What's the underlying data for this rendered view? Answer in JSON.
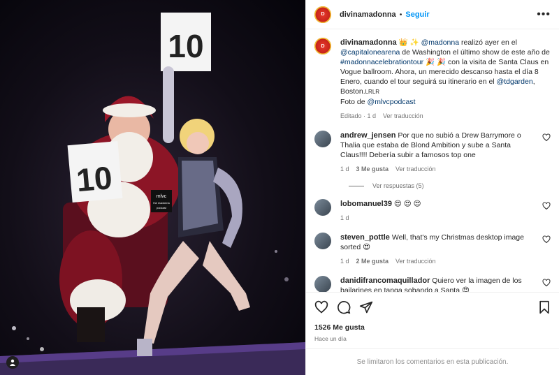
{
  "post": {
    "username": "divinamadonna",
    "follow_label": "Seguir",
    "more_label": "•••",
    "avatar_text": "D",
    "caption": {
      "badges": "👑 ✨",
      "mention_1": "@madonna",
      "text_1": " realizó ayer en el ",
      "mention_2": "@capitalonearena",
      "text_2": " de Washington el último show de este año de ",
      "hashtag": "#madonnacelebrationtour",
      "text_3": " 🎉 🎉  con la visita de Santa Claus en Vogue ballroom. Ahora, un merecido descanso hasta el día 8 Enero, cuando el tour seguirá su itinerario en el ",
      "mention_3": "@tdgarden",
      "text_4": ", Boston.",
      "small_tag": "LRLR",
      "photo_credit": "Foto de ",
      "mention_4": "@mlvcpodcast",
      "edited": "Editado",
      "time": "1 d",
      "translate": "Ver traducción"
    }
  },
  "comments": [
    {
      "user": "andrew_jensen",
      "text": "Por que no subió a Drew Barrymore o Thalia que estaba de Blond Ambition y sube a Santa Claus!!!! Debería subir a famosos top one",
      "time": "1 d",
      "likes": "3 Me gusta",
      "translate": "Ver traducción",
      "replies": "Ver respuestas (5)"
    },
    {
      "user": "lobomanuel39",
      "text": "😍 😍 😍",
      "time": "1 d"
    },
    {
      "user": "steven_pottle",
      "text": "Well, that's my Christmas desktop image sorted 😍",
      "time": "1 d",
      "likes": "2 Me gusta",
      "translate": "Ver traducción"
    },
    {
      "user": "danidifrancomaquillador",
      "text": "Quiero ver la imagen de los bailarines en tanga sobando a Santa 😍"
    }
  ],
  "actions": {
    "likes": "1526 Me gusta",
    "ago": "Hace un día",
    "icons": [
      "heart-icon",
      "comment-icon",
      "share-icon",
      "bookmark-icon"
    ]
  },
  "footer": {
    "text": "Se limitaron los comentarios en esta publicación."
  },
  "photo": {
    "sign_left": "10",
    "sign_right": "10",
    "logo_line1": "mlvc",
    "logo_line2": "the madonna",
    "logo_line3": "podcast"
  },
  "colors": {
    "link": "#00376b",
    "follow": "#0095f6",
    "muted": "#737373"
  }
}
